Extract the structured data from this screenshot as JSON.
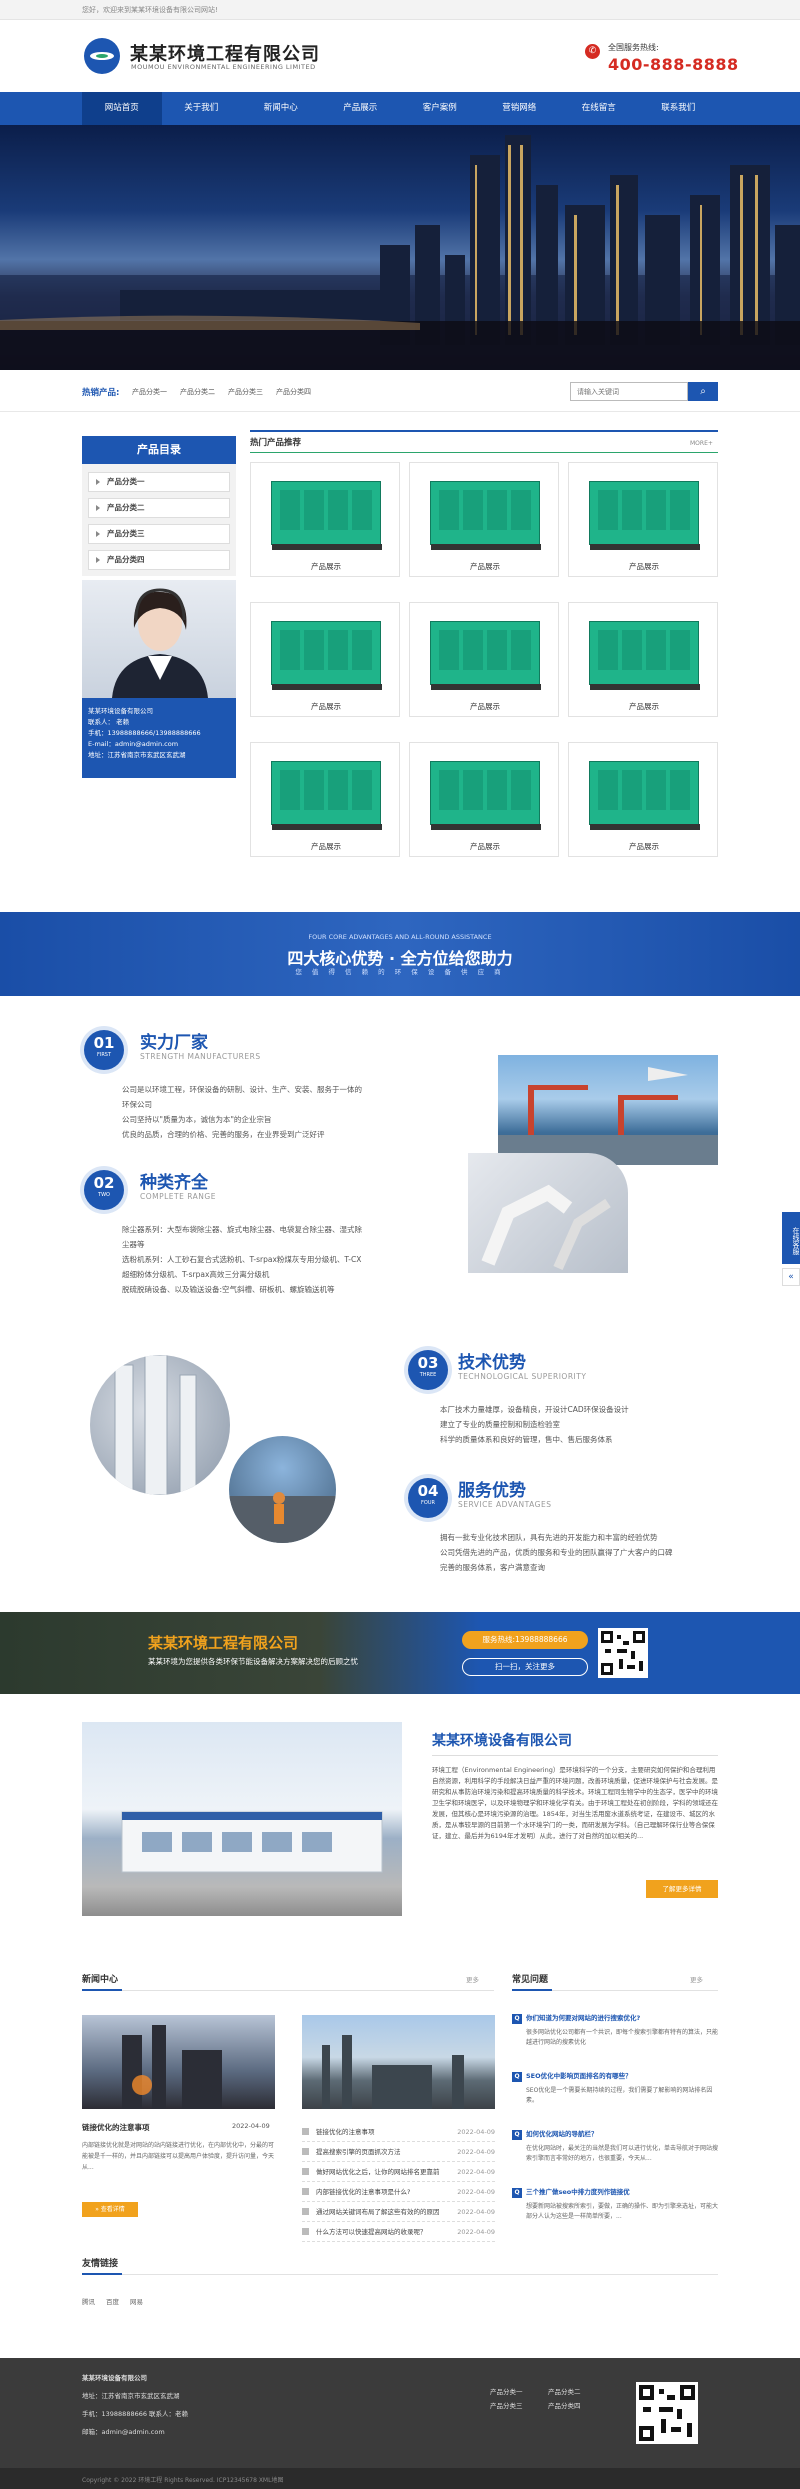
{
  "topbar": {
    "welcome": "您好，欢迎来到某某环境设备有限公司网站!"
  },
  "header": {
    "company": "某某环境工程有限公司",
    "company_en": "MOUMOU ENVIRONMENTAL ENGINEERING LIMITED",
    "hotline_label": "全国服务热线:",
    "hotline": "400-888-8888"
  },
  "nav": {
    "items": [
      "网站首页",
      "关于我们",
      "新闻中心",
      "产品展示",
      "客户案例",
      "营销网络",
      "在线留言",
      "联系我们"
    ]
  },
  "hot": {
    "label": "热销产品:",
    "items": [
      "产品分类一",
      "产品分类二",
      "产品分类三",
      "产品分类四"
    ],
    "search_placeholder": "请输入关键词"
  },
  "sidebar": {
    "title": "产品目录",
    "categories": [
      "产品分类一",
      "产品分类二",
      "产品分类三",
      "产品分类四"
    ],
    "contact": {
      "company": "某某环境设备有限公司",
      "person": "联系人：  老赖",
      "phone": "手机：13988888666/13988888666",
      "email": "E-mail：admin@admin.com",
      "address": "地址：江苏省南京市玄武区玄武湖"
    }
  },
  "products": {
    "title": "热门产品推荐",
    "more": "MORE+",
    "items": [
      "产品展示",
      "产品展示",
      "产品展示",
      "产品展示",
      "产品展示",
      "产品展示",
      "产品展示",
      "产品展示",
      "产品展示"
    ]
  },
  "advantages": {
    "en": "FOUR CORE ADVANTAGES AND ALL-ROUND ASSISTANCE",
    "title": "四大核心优势 · 全方位给您助力",
    "subtitle": "您 值 得 信 赖 的 环 保 设 备 供 应 商",
    "items": [
      {
        "num": "01",
        "tag": "FIRST",
        "title": "实力厂家",
        "en": "STRENGTH MANUFACTURERS",
        "lines": [
          "公司是以环境工程，环保设备的研制、设计、生产、安装、服务于一体的",
          "环保公司",
          "公司坚持以\"质量为本，诚信为本\"的企业宗旨",
          "优良的品质，合理的价格、完善的服务，在业界受到广泛好评"
        ]
      },
      {
        "num": "02",
        "tag": "TWO",
        "title": "种类齐全",
        "en": "COMPLETE RANGE",
        "lines": [
          "除尘器系列：大型布袋除尘器、旋式电除尘器、电袋复合除尘器、湿式除",
          "尘器等",
          "选粉机系列：人工砂石复合式选粉机、T-srpax粉煤灰专用分级机、T-CX",
          "超细粉体分级机、T-srpax高效三分离分级机",
          "脱硫脱硝设备、以及输送设备:空气斜槽、研板机、螺旋输送机等"
        ]
      },
      {
        "num": "03",
        "tag": "THREE",
        "title": "技术优势",
        "en": "TECHNOLOGICAL SUPERIORITY",
        "lines": [
          "本厂技术力量雄厚，设备精良，开设计CAD环保设备设计",
          "建立了专业的质量控制和制造检验室",
          "科学的质量体系和良好的管理，售中、售后服务体系"
        ]
      },
      {
        "num": "04",
        "tag": "FOUR",
        "title": "服务优势",
        "en": "SERVICE ADVANTAGES",
        "lines": [
          "拥有一批专业化技术团队，具有先进的开发能力和丰富的经验优势",
          "公司凭借先进的产品，优质的服务和专业的团队赢得了广大客户的口碑",
          "完善的服务体系，客户满意查询"
        ]
      }
    ]
  },
  "cta": {
    "name": "某某环境工程有限公司",
    "text": "某某环境为您提供各类环保节能设备解决方案解决您的后顾之忧",
    "phone": "服务热线:13988888666",
    "scan": "扫一扫，关注更多"
  },
  "about": {
    "title": "某某环境设备有限公司",
    "text": "环境工程（Environmental Engineering）是环境科学的一个分支，主要研究如何保护和合理利用自然资源，利用科学的手段解决日益严重的环境问题，改善环境质量，促进环境保护与社会发展。是研究和从事防治环境污染和提高环境质量的科学技术。环境工程同生物学中的生态学，医学中的环境卫生学和环境医学，以及环境物理学和环境化学有关。由于环境工程处在初创阶段，学科的领域还在发展，但其核心是环境污染源的治理。1854年，对当生活用废水道系统考证，在建设市、城区的水质，是从事较早源的目前第一个水环境学门的一类，而研发展为学科。（自己理解环保行业等合保保证，建立、最后并为6194年才发明）从此，进行了对自然的加以相关的...",
    "button": "了解更多详情"
  },
  "news": {
    "title": "新闻中心",
    "more": "更多",
    "featured": {
      "title": "链接优化的注意事项",
      "date": "2022-04-09",
      "summary": "内部链接优化就是对网站的站内链接进行优化，在内部优化中，分最的可能被是千一样的，并且内部链接可以提高用户体验度，提升访问量，今天从...",
      "button": "查看详情"
    },
    "list": [
      {
        "title": "链接优化的注意事项",
        "date": "2022-04-09"
      },
      {
        "title": "提高搜索引擎的页面抓次方法",
        "date": "2022-04-09"
      },
      {
        "title": "做好网站优化之后，让你的网站排名更靠前",
        "date": "2022-04-09"
      },
      {
        "title": "内部链接优化的注意事项是什么?",
        "date": "2022-04-09"
      },
      {
        "title": "通过网站关键词布局了解这些有效的的原因",
        "date": "2022-04-09"
      },
      {
        "title": "什么方法可以快速提高网站的收录呢？",
        "date": "2022-04-09"
      }
    ]
  },
  "faq": {
    "title": "常见问题",
    "more": "更多",
    "items": [
      {
        "q": "你们知道为何要对网站的进行搜索优化?",
        "a": "很多网站优化公司都有一个共识，即每个搜索引擎都有特有的算法，只能越进行网站的搜素优化"
      },
      {
        "q": "SEO优化中影响页面排名的有哪些？",
        "a": "SEO优化是一个需要长期持续的过程，我们需要了解影响的网站排名因素。"
      },
      {
        "q": "如何优化网站的导航栏？",
        "a": "在优化网站时，最关注的当然是我们可以进行优化，单击导航对于网站搜索引擎而言非常好的地方，也很重要，今天从..."
      },
      {
        "q": "三个推广做seo中排力度列作链接优",
        "a": "想要新网站被搜索所索引，要做，正确的操作、即为引擎来选址，可能大部分人认为这些是一样简单所要，..."
      }
    ]
  },
  "links": {
    "title": "友情链接",
    "items": [
      "腾讯",
      "百度",
      "网易"
    ]
  },
  "footer": {
    "company": "某某环境设备有限公司",
    "address": "地址：江苏省南京市玄武区玄武湖",
    "phone": "手机：13988888666  联系人：老赖",
    "email": "邮箱：admin@admin.com",
    "links": [
      "产品分类一",
      "产品分类二",
      "产品分类三",
      "产品分类四"
    ],
    "copyright": "Copyright © 2022 环境工程 Rights Reserved. ICP12345678 XML地图"
  },
  "side": {
    "tab": "在线客服",
    "arrow": "«"
  }
}
